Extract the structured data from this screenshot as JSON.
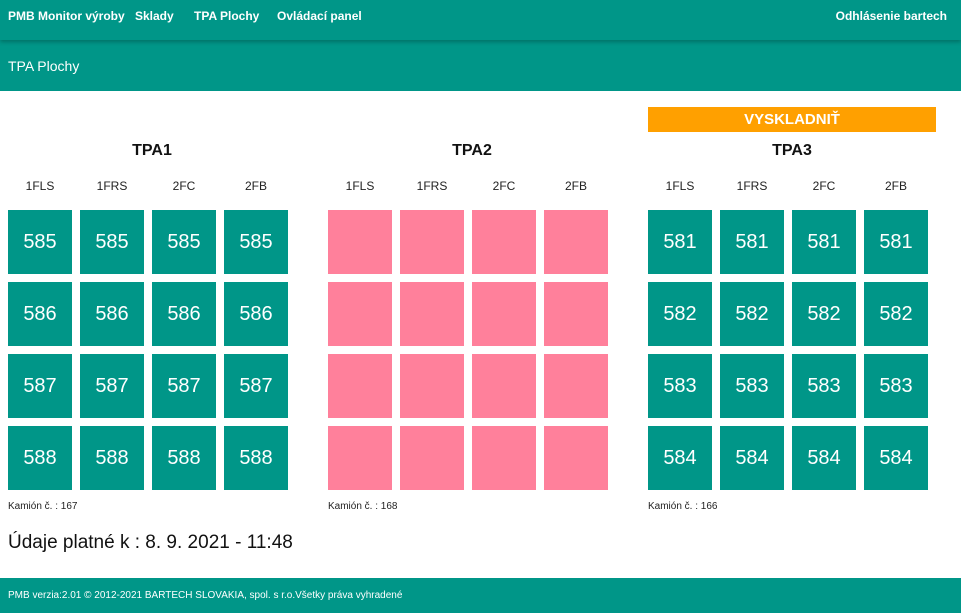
{
  "nav": {
    "items": [
      "PMB Monitor výroby",
      "Sklady",
      "TPA Plochy",
      "Ovládací panel"
    ],
    "logout": "Odhlásenie bartech"
  },
  "page": {
    "title": "TPA Plochy",
    "action_button": "VYSKLADNIŤ",
    "validity": "Údaje platné k : 8. 9. 2021 - 11:48"
  },
  "colors": {
    "primary": "#009688",
    "accent": "#ffa000",
    "empty": "#ff809b"
  },
  "groups": [
    {
      "title": "TPA1",
      "columns": [
        "1FLS",
        "1FRS",
        "2FC",
        "2FB"
      ],
      "rows": [
        [
          "585",
          "585",
          "585",
          "585"
        ],
        [
          "586",
          "586",
          "586",
          "586"
        ],
        [
          "587",
          "587",
          "587",
          "587"
        ],
        [
          "588",
          "588",
          "588",
          "588"
        ]
      ],
      "status": "filled",
      "truck": "Kamión č. : 167"
    },
    {
      "title": "TPA2",
      "columns": [
        "1FLS",
        "1FRS",
        "2FC",
        "2FB"
      ],
      "rows": [
        [
          "",
          "",
          "",
          ""
        ],
        [
          "",
          "",
          "",
          ""
        ],
        [
          "",
          "",
          "",
          ""
        ],
        [
          "",
          "",
          "",
          ""
        ]
      ],
      "status": "empty",
      "truck": "Kamión č. : 168"
    },
    {
      "title": "TPA3",
      "columns": [
        "1FLS",
        "1FRS",
        "2FC",
        "2FB"
      ],
      "rows": [
        [
          "581",
          "581",
          "581",
          "581"
        ],
        [
          "582",
          "582",
          "582",
          "582"
        ],
        [
          "583",
          "583",
          "583",
          "583"
        ],
        [
          "584",
          "584",
          "584",
          "584"
        ]
      ],
      "status": "filled",
      "truck": "Kamión č. : 166"
    }
  ],
  "footer": {
    "text": "PMB verzia:2.01 © 2012-2021 BARTECH SLOVAKIA, spol. s r.o.Všetky práva vyhradené"
  }
}
